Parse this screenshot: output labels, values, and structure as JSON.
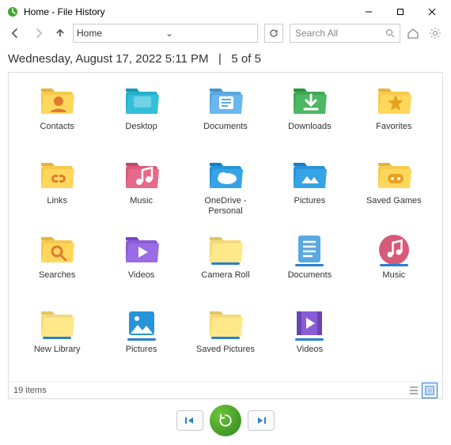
{
  "window": {
    "title": "Home - File History"
  },
  "toolbar": {
    "address": "Home",
    "search_placeholder": "Search All"
  },
  "header": {
    "datetime": "Wednesday, August 17, 2022 5:11 PM",
    "page_indicator": "5 of 5"
  },
  "items": [
    {
      "label": "Contacts",
      "kind": "folder-contacts"
    },
    {
      "label": "Desktop",
      "kind": "folder-desktop"
    },
    {
      "label": "Documents",
      "kind": "folder-documents"
    },
    {
      "label": "Downloads",
      "kind": "folder-downloads"
    },
    {
      "label": "Favorites",
      "kind": "folder-favorites"
    },
    {
      "label": "Links",
      "kind": "folder-links"
    },
    {
      "label": "Music",
      "kind": "folder-music"
    },
    {
      "label": "OneDrive - Personal",
      "kind": "folder-onedrive"
    },
    {
      "label": "Pictures",
      "kind": "folder-pictures"
    },
    {
      "label": "Saved Games",
      "kind": "folder-savedgames"
    },
    {
      "label": "Searches",
      "kind": "folder-searches"
    },
    {
      "label": "Videos",
      "kind": "folder-videos"
    },
    {
      "label": "Camera Roll",
      "kind": "library-generic"
    },
    {
      "label": "Documents",
      "kind": "library-documents"
    },
    {
      "label": "Music",
      "kind": "library-music"
    },
    {
      "label": "New Library",
      "kind": "library-generic"
    },
    {
      "label": "Pictures",
      "kind": "library-pictures"
    },
    {
      "label": "Saved Pictures",
      "kind": "library-generic"
    },
    {
      "label": "Videos",
      "kind": "library-videos"
    }
  ],
  "status": {
    "count_label": "19 items"
  },
  "colors": {
    "accent_green": "#3fa62b",
    "folder_yellow": "#f7c94c",
    "folder_blue": "#2793d9",
    "folder_purple": "#8a5cd6"
  }
}
